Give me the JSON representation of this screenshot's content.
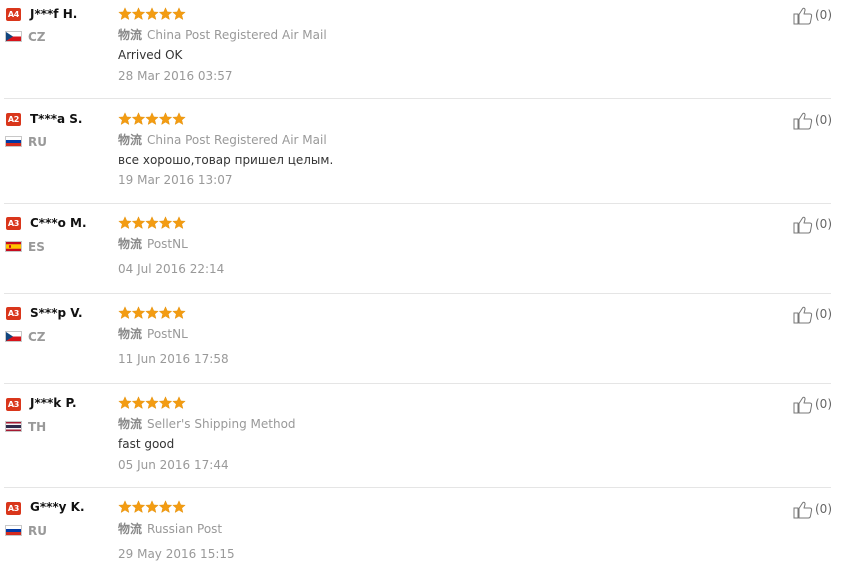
{
  "logistics_label": "物流",
  "icons": {
    "star": "star-icon",
    "thumb": "thumbs-up-icon",
    "flag": "country-flag-icon"
  },
  "colors": {
    "level_badge": "#d9361b",
    "star": "#f39c12",
    "divider": "#e5e5e5",
    "muted_text": "#999999"
  },
  "reviews": [
    {
      "level": "A4",
      "name": "J***f H.",
      "country": "CZ",
      "rating": 5,
      "shipping": "China Post Registered Air Mail",
      "text": "Arrived OK",
      "date": "28 Mar 2016 03:57",
      "helpful": "(0)"
    },
    {
      "level": "A2",
      "name": "T***a S.",
      "country": "RU",
      "rating": 5,
      "shipping": "China Post Registered Air Mail",
      "text": "все хорошо,товар пришел целым.",
      "date": "19 Mar 2016 13:07",
      "helpful": "(0)"
    },
    {
      "level": "A3",
      "name": "C***o M.",
      "country": "ES",
      "rating": 5,
      "shipping": "PostNL",
      "text": "",
      "date": "04 Jul 2016 22:14",
      "helpful": "(0)"
    },
    {
      "level": "A3",
      "name": "S***p V.",
      "country": "CZ",
      "rating": 5,
      "shipping": "PostNL",
      "text": "",
      "date": "11 Jun 2016 17:58",
      "helpful": "(0)"
    },
    {
      "level": "A3",
      "name": "J***k P.",
      "country": "TH",
      "rating": 5,
      "shipping": "Seller's Shipping Method",
      "text": "fast good",
      "date": "05 Jun 2016 17:44",
      "helpful": "(0)"
    },
    {
      "level": "A3",
      "name": "G***y K.",
      "country": "RU",
      "rating": 5,
      "shipping": "Russian Post",
      "text": "",
      "date": "29 May 2016 15:15",
      "helpful": "(0)"
    }
  ]
}
